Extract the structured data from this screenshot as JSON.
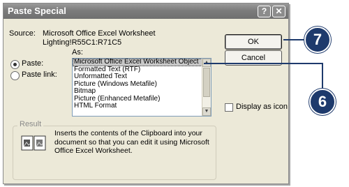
{
  "dialog": {
    "title": "Paste Special",
    "help_button": "?",
    "close_button": "✕",
    "source_label": "Source:",
    "source_line1": "Microsoft Office Excel Worksheet",
    "source_line2": "Lighting!R55C1:R71C5",
    "as_label": "As:",
    "paste_label": "Paste:",
    "paste_link_label": "Paste link:",
    "paste_selected": "paste",
    "list_items": [
      "Microsoft Office Excel Worksheet Object",
      "Formatted Text (RTF)",
      "Unformatted Text",
      "Picture (Windows Metafile)",
      "Bitmap",
      "Picture (Enhanced Metafile)",
      "HTML Format"
    ],
    "selected_index": 0,
    "ok_label": "OK",
    "cancel_label": "Cancel",
    "display_as_icon_label": "Display as icon",
    "display_as_icon_checked": false,
    "result_label": "Result",
    "result_text": "Inserts the contents of the Clipboard into your document so that you can edit it using Microsoft Office Excel Worksheet."
  },
  "callouts": {
    "ok_step": "7",
    "list_step": "6",
    "color": "#1e3a6c"
  }
}
